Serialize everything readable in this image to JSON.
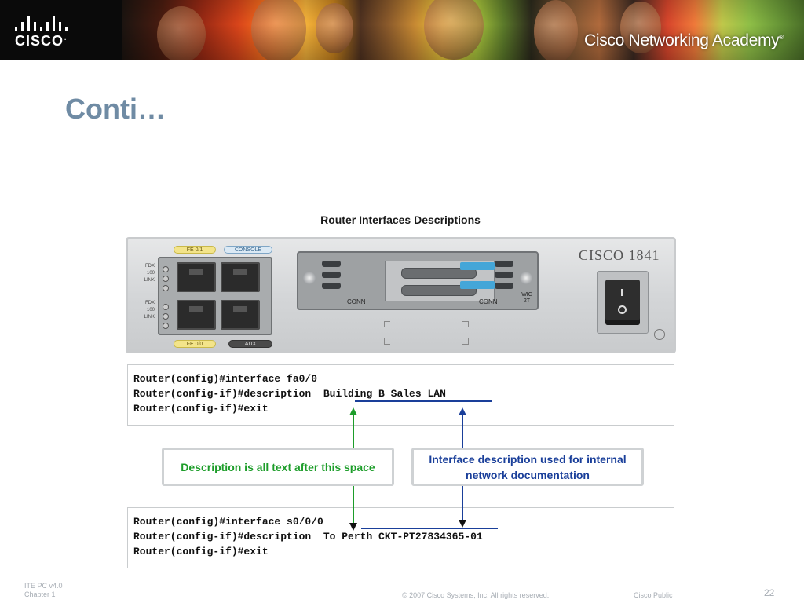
{
  "banner": {
    "logo_text": "CISCO",
    "academy_name_1": "Cisco",
    "academy_name_2": "Networking Academy"
  },
  "slide": {
    "title": "Conti…"
  },
  "figure": {
    "title": "Router Interfaces Descriptions",
    "router_model": "CISCO 1841",
    "port_labels": [
      "FE 0/1",
      "CONSOLE",
      "FE 0/0",
      "AUX"
    ],
    "led_labels": [
      "FDX",
      "100",
      "LINK",
      "FDX",
      "100",
      "LINK"
    ],
    "slot_labels": [
      "CONN",
      "CONN",
      "WIC 2T"
    ]
  },
  "cli_top": {
    "lines": [
      "Router(config)#interface fa0/0",
      "Router(config-if)#description  Building B Sales LAN",
      "Router(config-if)#exit"
    ]
  },
  "cli_bottom": {
    "lines": [
      "Router(config)#interface s0/0/0",
      "Router(config-if)#description  To Perth CKT-PT27834365-01",
      "Router(config-if)#exit"
    ]
  },
  "callouts": {
    "left": "Description is all text after this space",
    "right": "Interface description used for internal network documentation"
  },
  "colors": {
    "title": "#6f8ba4",
    "green_arrow": "#1d9d2a",
    "blue_arrow": "#1a3f9a"
  },
  "footer": {
    "course": "ITE PC v4.0",
    "chapter": "Chapter 1",
    "copyright": "© 2007 Cisco Systems, Inc. All rights reserved.",
    "classification": "Cisco Public",
    "page": "22"
  }
}
